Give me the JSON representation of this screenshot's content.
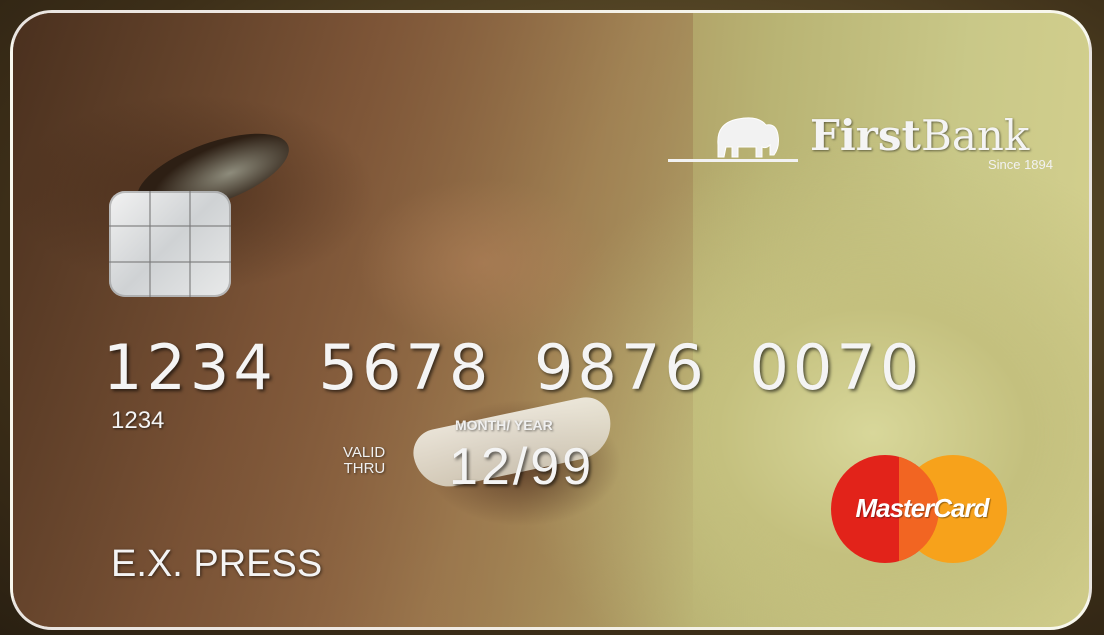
{
  "bank": {
    "name_bold": "First",
    "name_regular": "Bank",
    "since": "Since 1894"
  },
  "card": {
    "number": "1234 5678 9876 0070",
    "short_number": "1234",
    "month_year_label": "MONTH/ YEAR",
    "valid_label_line1": "VALID",
    "valid_label_line2": "THRU",
    "expiry": "12/99",
    "holder_name": "E.X. PRESS"
  },
  "network": {
    "name": "MasterCard",
    "colors": {
      "red": "#e2231a",
      "orange": "#f7a21b"
    }
  }
}
